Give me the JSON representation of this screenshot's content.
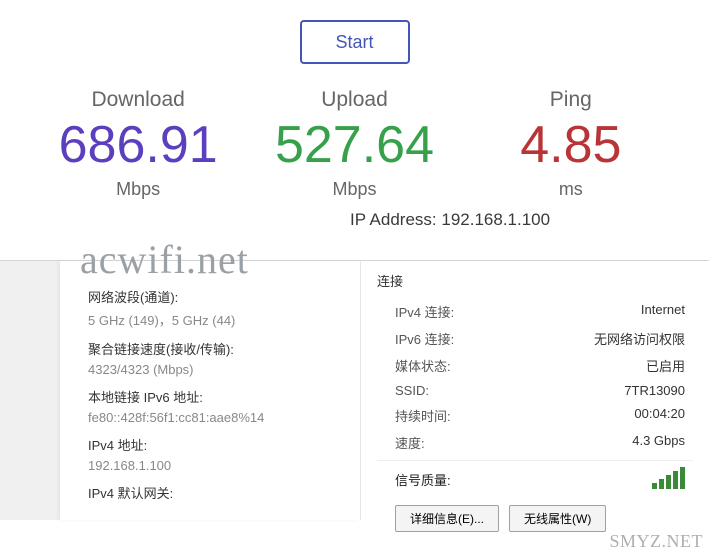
{
  "start_button": "Start",
  "metrics": {
    "download": {
      "label": "Download",
      "value": "686.91",
      "unit": "Mbps"
    },
    "upload": {
      "label": "Upload",
      "value": "527.64",
      "unit": "Mbps"
    },
    "ping": {
      "label": "Ping",
      "value": "4.85",
      "unit": "ms"
    }
  },
  "ip_label": "IP Address:",
  "ip_value": "192.168.1.100",
  "watermark": "acwifi.net",
  "left_panel": {
    "band_label": "网络波段(通道):",
    "band_value": "5 GHz (149)，5 GHz (44)",
    "aggr_label": "聚合链接速度(接收/传输):",
    "aggr_value": "4323/4323 (Mbps)",
    "linklocal_label": "本地链接 IPv6 地址:",
    "linklocal_value": "fe80::428f:56f1:cc81:aae8%14",
    "ipv4_label": "IPv4 地址:",
    "ipv4_value": "192.168.1.100",
    "gw_label": "IPv4 默认网关:"
  },
  "right_panel": {
    "title": "连接",
    "rows": {
      "ipv4_conn": {
        "key": "IPv4 连接:",
        "value": "Internet"
      },
      "ipv6_conn": {
        "key": "IPv6 连接:",
        "value": "无网络访问权限"
      },
      "media": {
        "key": "媒体状态:",
        "value": "已启用"
      },
      "ssid": {
        "key": "SSID:",
        "value": "7TR13090"
      },
      "duration": {
        "key": "持续时间:",
        "value": "00:04:20"
      },
      "speed": {
        "key": "速度:",
        "value": "4.3 Gbps"
      }
    },
    "signal_label": "信号质量:",
    "details_btn": "详细信息(E)...",
    "wireless_btn": "无线属性(W)"
  },
  "footer_watermark": "SMYZ.NET"
}
